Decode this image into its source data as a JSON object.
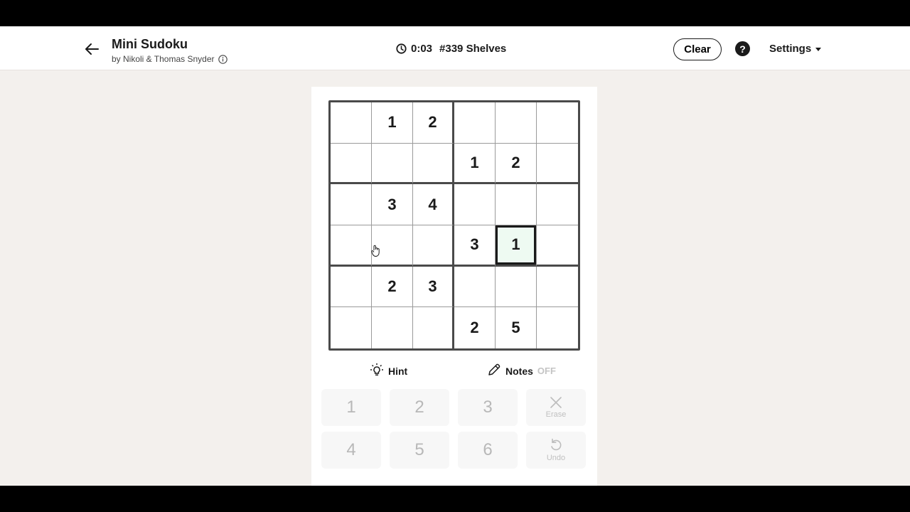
{
  "header": {
    "title": "Mini Sudoku",
    "byline": "by Nikoli & Thomas Snyder",
    "timer": "0:03",
    "puzzle_label": "#339 Shelves",
    "clear_label": "Clear",
    "help_label": "?",
    "settings_label": "Settings"
  },
  "board": {
    "size": 6,
    "cells": [
      [
        "",
        "1",
        "2",
        "",
        "",
        ""
      ],
      [
        "",
        "",
        "",
        "1",
        "2",
        ""
      ],
      [
        "",
        "3",
        "4",
        "",
        "",
        ""
      ],
      [
        "",
        "",
        "",
        "3",
        "1",
        ""
      ],
      [
        "",
        "2",
        "3",
        "",
        "",
        ""
      ],
      [
        "",
        "",
        "",
        "2",
        "5",
        ""
      ]
    ],
    "selected": {
      "row": 3,
      "col": 4
    }
  },
  "tools": {
    "hint_label": "Hint",
    "notes_label": "Notes",
    "notes_state": "OFF"
  },
  "keypad": {
    "row1": [
      "1",
      "2",
      "3"
    ],
    "row2": [
      "4",
      "5",
      "6"
    ],
    "erase_label": "Erase",
    "undo_label": "Undo"
  },
  "colors": {
    "selected_cell_bg": "#eefaf2",
    "app_bg": "#f3f0ed",
    "disabled_text": "#b8b8b8"
  }
}
